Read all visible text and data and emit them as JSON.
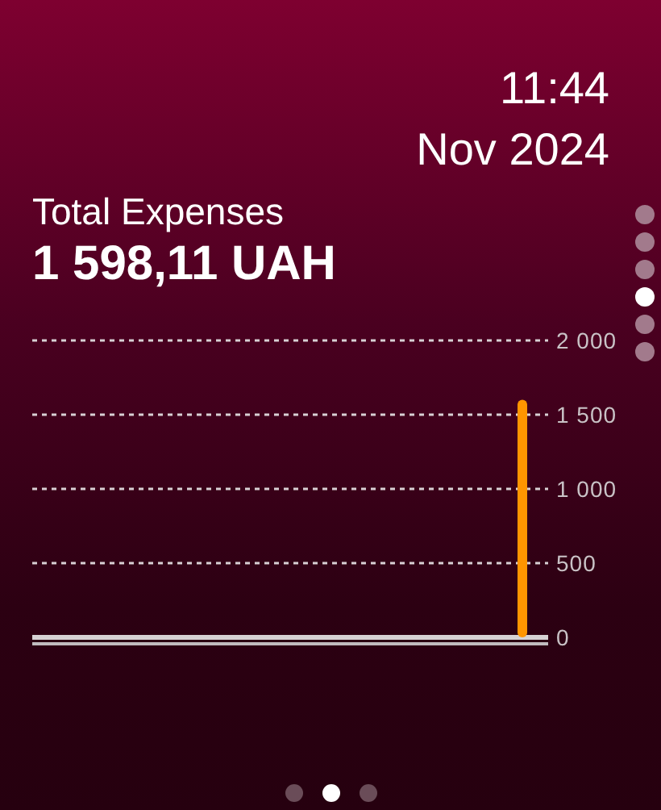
{
  "header": {
    "time": "11:44",
    "period": "Nov 2024"
  },
  "summary": {
    "label": "Total Expenses",
    "amount": "1 598,11 UAH"
  },
  "chart_data": {
    "type": "bar",
    "ylim": [
      0,
      2000
    ],
    "grid": true,
    "yticks": [
      {
        "value": 0,
        "label": "0"
      },
      {
        "value": 500,
        "label": "500"
      },
      {
        "value": 1000,
        "label": "1 000"
      },
      {
        "value": 1500,
        "label": "1 500"
      },
      {
        "value": 2000,
        "label": "2 000"
      }
    ],
    "series": [
      {
        "color": "#ff9500",
        "values": [
          0,
          0,
          0,
          0,
          0,
          0,
          0,
          0,
          0,
          0,
          0,
          0,
          0,
          0,
          0,
          0,
          0,
          0,
          0,
          0,
          0,
          0,
          0,
          0,
          0,
          0,
          0,
          0,
          1600,
          0
        ]
      }
    ]
  },
  "vertical_pages": [
    {
      "selected": false
    },
    {
      "selected": false
    },
    {
      "selected": false
    },
    {
      "selected": true
    },
    {
      "selected": false
    },
    {
      "selected": false
    }
  ],
  "horizontal_pages": [
    {
      "selected": false
    },
    {
      "selected": true
    },
    {
      "selected": false
    }
  ]
}
